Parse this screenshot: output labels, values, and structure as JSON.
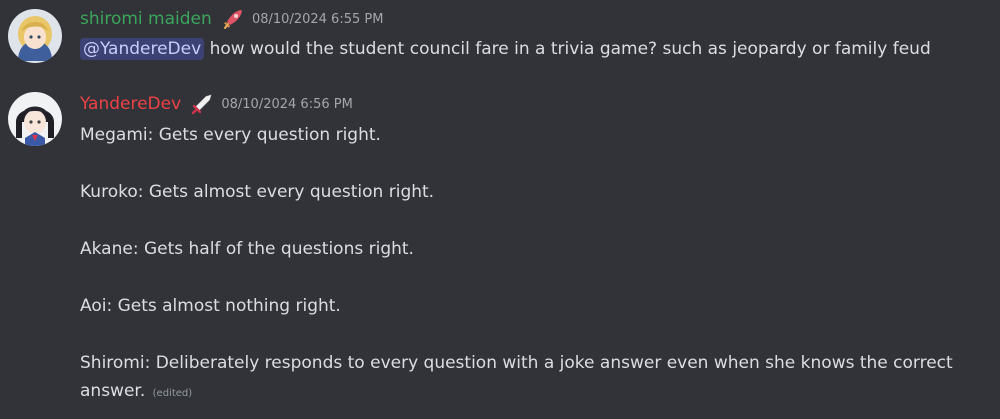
{
  "messages": [
    {
      "username": "shiromi maiden",
      "username_color": "#3ba55c",
      "role_icon": "rocket-icon",
      "timestamp": "08/10/2024 6:55 PM",
      "mention": "@YandereDev",
      "text": " how would the student council fare in a trivia game? such as jeopardy or family feud"
    },
    {
      "username": "YandereDev",
      "username_color": "#ed4245",
      "role_icon": "sword-icon",
      "timestamp": "08/10/2024 6:56 PM",
      "lines": [
        "Megami: Gets every question right.",
        "Kuroko: Gets almost every question right.",
        "Akane: Gets half of the questions right.",
        "Aoi: Gets almost nothing right.",
        "Shiromi: Deliberately responds to every question with a joke answer even when she knows the correct answer."
      ],
      "edited_label": "(edited)"
    }
  ]
}
